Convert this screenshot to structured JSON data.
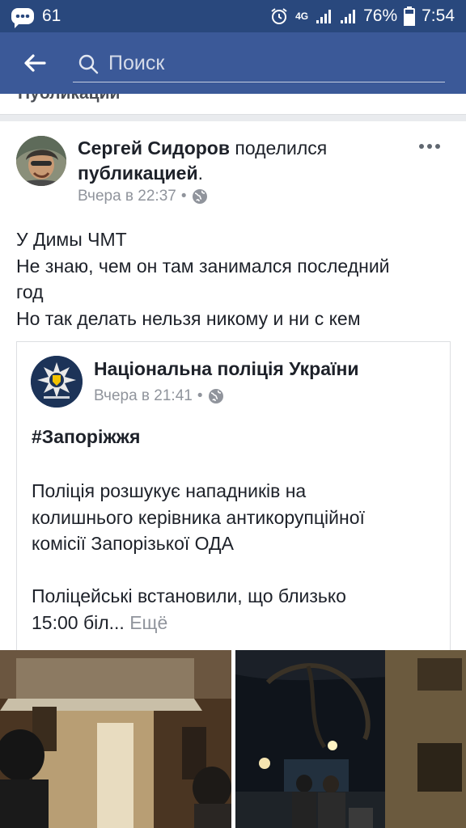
{
  "status_bar": {
    "notification_count": "61",
    "network_label": "4G",
    "battery": "76%",
    "time": "7:54"
  },
  "search": {
    "placeholder": "Поиск"
  },
  "section_peek": "Публикации",
  "post": {
    "author": "Сергей Сидоров",
    "action_text": " поделился ",
    "object": "публикацией",
    "object_suffix": ".",
    "timestamp": "Вчера в 22:37",
    "separator": "•",
    "text_lines": [
      "У Димы ЧМТ",
      "Не знаю, чем он там занимался последний",
      "год",
      "Но так делать нельзя никому и ни с кем"
    ]
  },
  "shared": {
    "page_name": "Національна поліція України",
    "timestamp": "Вчера в 21:41",
    "separator": "•",
    "hashtag": "#Запоріжжя",
    "paragraph1_lines": [
      "Поліція розшукує нападників на",
      "колишнього керівника антикорупційної",
      "комісії Запорізької ОДА"
    ],
    "paragraph2_lines": [
      "Поліцейські встановили, що близько",
      "15:00 біл..."
    ],
    "see_more": "Ещё"
  },
  "colors": {
    "status_bar": "#29487d",
    "app_bar": "#3b5998",
    "text": "#1d2129",
    "meta": "#90949c"
  }
}
